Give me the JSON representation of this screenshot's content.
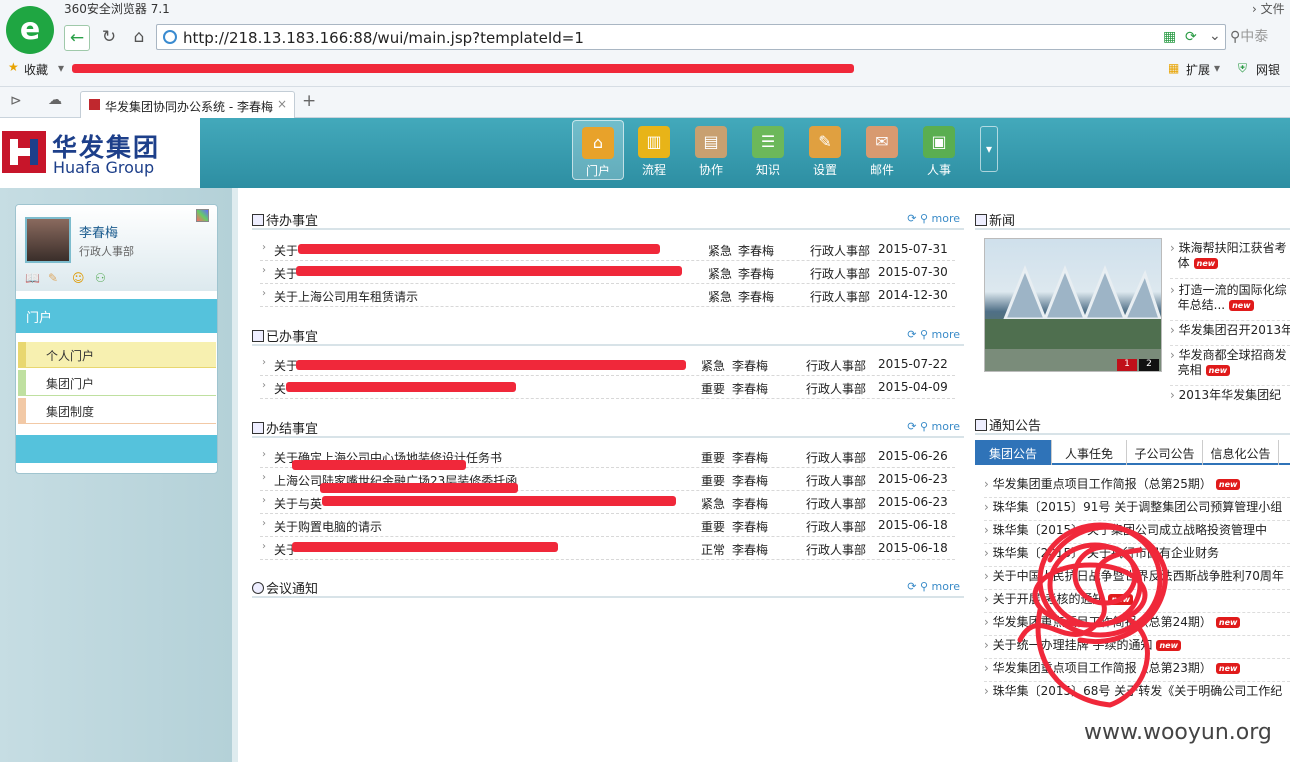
{
  "browser": {
    "title": "360安全浏览器 7.1",
    "menu_text": "文件",
    "url": "http://218.13.183.166:88/wui/main.jsp?templateId=1",
    "search_text": "中泰",
    "favorites_label": "收藏",
    "extensions_label": "扩展",
    "netbank_label": "网银",
    "tab_title": "华发集团协同办公系统 - 李春梅"
  },
  "app": {
    "logo_cn": "华发集团",
    "logo_en": "Huafa Group",
    "nav": [
      {
        "label": "门户",
        "icon": "home-icon",
        "active": true
      },
      {
        "label": "流程",
        "icon": "chart-icon"
      },
      {
        "label": "协作",
        "icon": "clipboard-icon"
      },
      {
        "label": "知识",
        "icon": "database-icon"
      },
      {
        "label": "设置",
        "icon": "wrench-icon"
      },
      {
        "label": "邮件",
        "icon": "mail-icon"
      },
      {
        "label": "人事",
        "icon": "window-icon"
      }
    ]
  },
  "user": {
    "name": "李春梅",
    "dept": "行政人事部"
  },
  "sidebar": {
    "section": "门户",
    "items": [
      "个人门户",
      "集团门户",
      "集团制度"
    ]
  },
  "panels": {
    "more": "more",
    "todo": {
      "title": "待办事宜",
      "rows": [
        {
          "title": "关于",
          "level": "紧急",
          "person": "李春梅",
          "dept": "行政人事部",
          "date": "2015-07-31"
        },
        {
          "title": "关于",
          "level": "紧急",
          "person": "李春梅",
          "dept": "行政人事部",
          "date": "2015-07-30"
        },
        {
          "title": "关于上海公司用车租赁请示",
          "level": "紧急",
          "person": "李春梅",
          "dept": "行政人事部",
          "date": "2014-12-30"
        }
      ]
    },
    "done": {
      "title": "已办事宜",
      "rows": [
        {
          "title": "关于",
          "level": "紧急",
          "person": "李春梅",
          "dept": "行政人事部",
          "date": "2015-07-22"
        },
        {
          "title": "关",
          "level": "重要",
          "person": "李春梅",
          "dept": "行政人事部",
          "date": "2015-04-09"
        }
      ]
    },
    "finished": {
      "title": "办结事宜",
      "rows": [
        {
          "title": "关于确定上海公司中心场地装修设计任务书",
          "level": "重要",
          "person": "李春梅",
          "dept": "行政人事部",
          "date": "2015-06-26"
        },
        {
          "title": "上海公司陆家嘴世纪金融广场23层装修委托函",
          "level": "重要",
          "person": "李春梅",
          "dept": "行政人事部",
          "date": "2015-06-23"
        },
        {
          "title": "关于与英",
          "level": "紧急",
          "person": "李春梅",
          "dept": "行政人事部",
          "date": "2015-06-23"
        },
        {
          "title": "关于购置电脑的请示",
          "level": "重要",
          "person": "李春梅",
          "dept": "行政人事部",
          "date": "2015-06-18"
        },
        {
          "title": "关于",
          "level": "正常",
          "person": "李春梅",
          "dept": "行政人事部",
          "date": "2015-06-18"
        }
      ]
    },
    "meeting": {
      "title": "会议通知"
    }
  },
  "news": {
    "title": "新闻",
    "pager": [
      "1",
      "2"
    ],
    "items": [
      {
        "text": "珠海帮扶阳江获省考",
        "text2": "体",
        "new": true
      },
      {
        "text": "打造一流的国际化综",
        "text2": "年总结...",
        "new": true
      },
      {
        "text": "华发集团召开2013年",
        "new": false
      },
      {
        "text": "华发商都全球招商发",
        "text2": "亮相",
        "new": true
      },
      {
        "text": "2013年华发集团纪",
        "new": false
      }
    ]
  },
  "notices": {
    "title": "通知公告",
    "tabs": [
      "集团公告",
      "人事任免",
      "子公司公告",
      "信息化公告"
    ],
    "new_label": "new",
    "items": [
      {
        "text": "华发集团重点项目工作简报（总第25期）",
        "new": true
      },
      {
        "text": "珠华集〔2015〕91号 关于调整集团公司预算管理小组",
        "new": false
      },
      {
        "text": "珠华集〔2015〕  关于集团公司成立战略投资管理中",
        "new": false
      },
      {
        "text": "珠华集〔2015〕  关于执行市国有企业财务",
        "new": false
      },
      {
        "text": "关于中国人民抗日战争暨世界反法西斯战争胜利70周年",
        "new": false
      },
      {
        "text": "关于开展    考核的通知",
        "new": true
      },
      {
        "text": "华发集团重点项目工作简报（总第24期）",
        "new": true
      },
      {
        "text": "关于统一办理挂牌    手续的通知",
        "new": true
      },
      {
        "text": "华发集团重点项目工作简报（总第23期）",
        "new": true
      },
      {
        "text": "珠华集〔2015〕68号 关于转发《关于明确公司工作纪",
        "new": false
      }
    ]
  },
  "watermark": "www.wooyun.org"
}
